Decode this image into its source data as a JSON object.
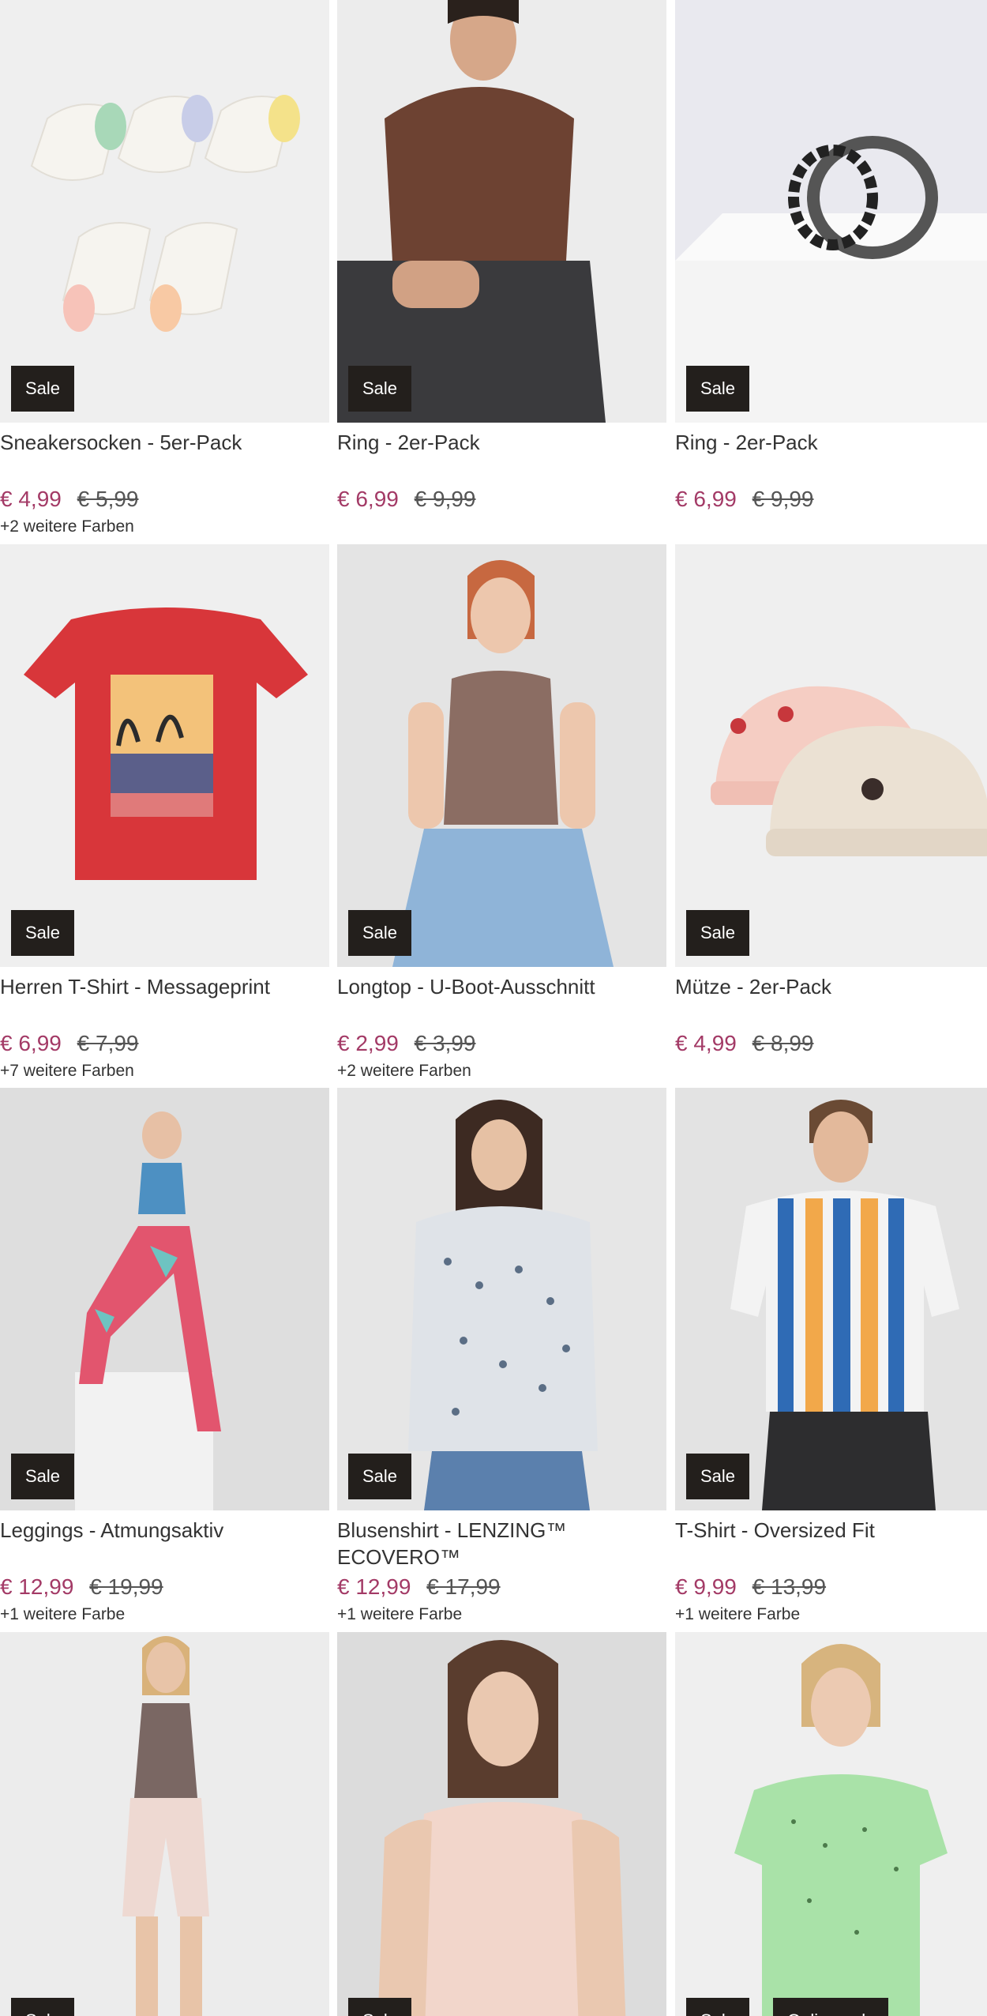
{
  "products": [
    {
      "title": "Sneakersocken - 5er-Pack",
      "price": "€ 4,99",
      "old_price": "€ 5,99",
      "colors": "+2 weitere Farben",
      "badges": [
        "Sale"
      ],
      "image": "socks-image"
    },
    {
      "title": "Ring - 2er-Pack",
      "price": "€ 6,99",
      "old_price": "€ 9,99",
      "colors": "",
      "badges": [
        "Sale"
      ],
      "image": "man-brown-shirt-image"
    },
    {
      "title": "Ring - 2er-Pack",
      "price": "€ 6,99",
      "old_price": "€ 9,99",
      "colors": "",
      "badges": [
        "Sale"
      ],
      "image": "rings-image"
    },
    {
      "title": "Herren T-Shirt - Messageprint",
      "price": "€ 6,99",
      "old_price": "€ 7,99",
      "colors": "+7 weitere Farben",
      "badges": [
        "Sale"
      ],
      "image": "red-tshirt-image"
    },
    {
      "title": "Longtop - U-Boot-Ausschnitt",
      "price": "€ 2,99",
      "old_price": "€ 3,99",
      "colors": "+2 weitere Farben",
      "badges": [
        "Sale"
      ],
      "image": "woman-longtop-image"
    },
    {
      "title": "Mütze - 2er-Pack",
      "price": "€ 4,99",
      "old_price": "€ 8,99",
      "colors": "",
      "badges": [
        "Sale"
      ],
      "image": "baby-hats-image"
    },
    {
      "title": "Leggings - Atmungsaktiv",
      "price": "€ 12,99",
      "old_price": "€ 19,99",
      "colors": "+1 weitere Farbe",
      "badges": [
        "Sale"
      ],
      "image": "woman-leggings-image"
    },
    {
      "title": "Blusenshirt - LENZING™ ECOVERO™",
      "price": "€ 12,99",
      "old_price": "€ 17,99",
      "colors": "+1 weitere Farbe",
      "badges": [
        "Sale"
      ],
      "image": "woman-blouse-image"
    },
    {
      "title": "T-Shirt - Oversized Fit",
      "price": "€ 9,99",
      "old_price": "€ 13,99",
      "colors": "+1 weitere Farbe",
      "badges": [
        "Sale"
      ],
      "image": "man-striped-shirt-image"
    },
    {
      "title": "",
      "price": "",
      "old_price": "",
      "colors": "",
      "badges": [
        "Sale"
      ],
      "image": "woman-shorts-image"
    },
    {
      "title": "",
      "price": "",
      "old_price": "",
      "colors": "",
      "badges": [
        "Sale"
      ],
      "image": "woman-pink-top-image"
    },
    {
      "title": "",
      "price": "",
      "old_price": "",
      "colors": "",
      "badges": [
        "Sale",
        "Online only"
      ],
      "image": "woman-green-shirt-image"
    }
  ]
}
